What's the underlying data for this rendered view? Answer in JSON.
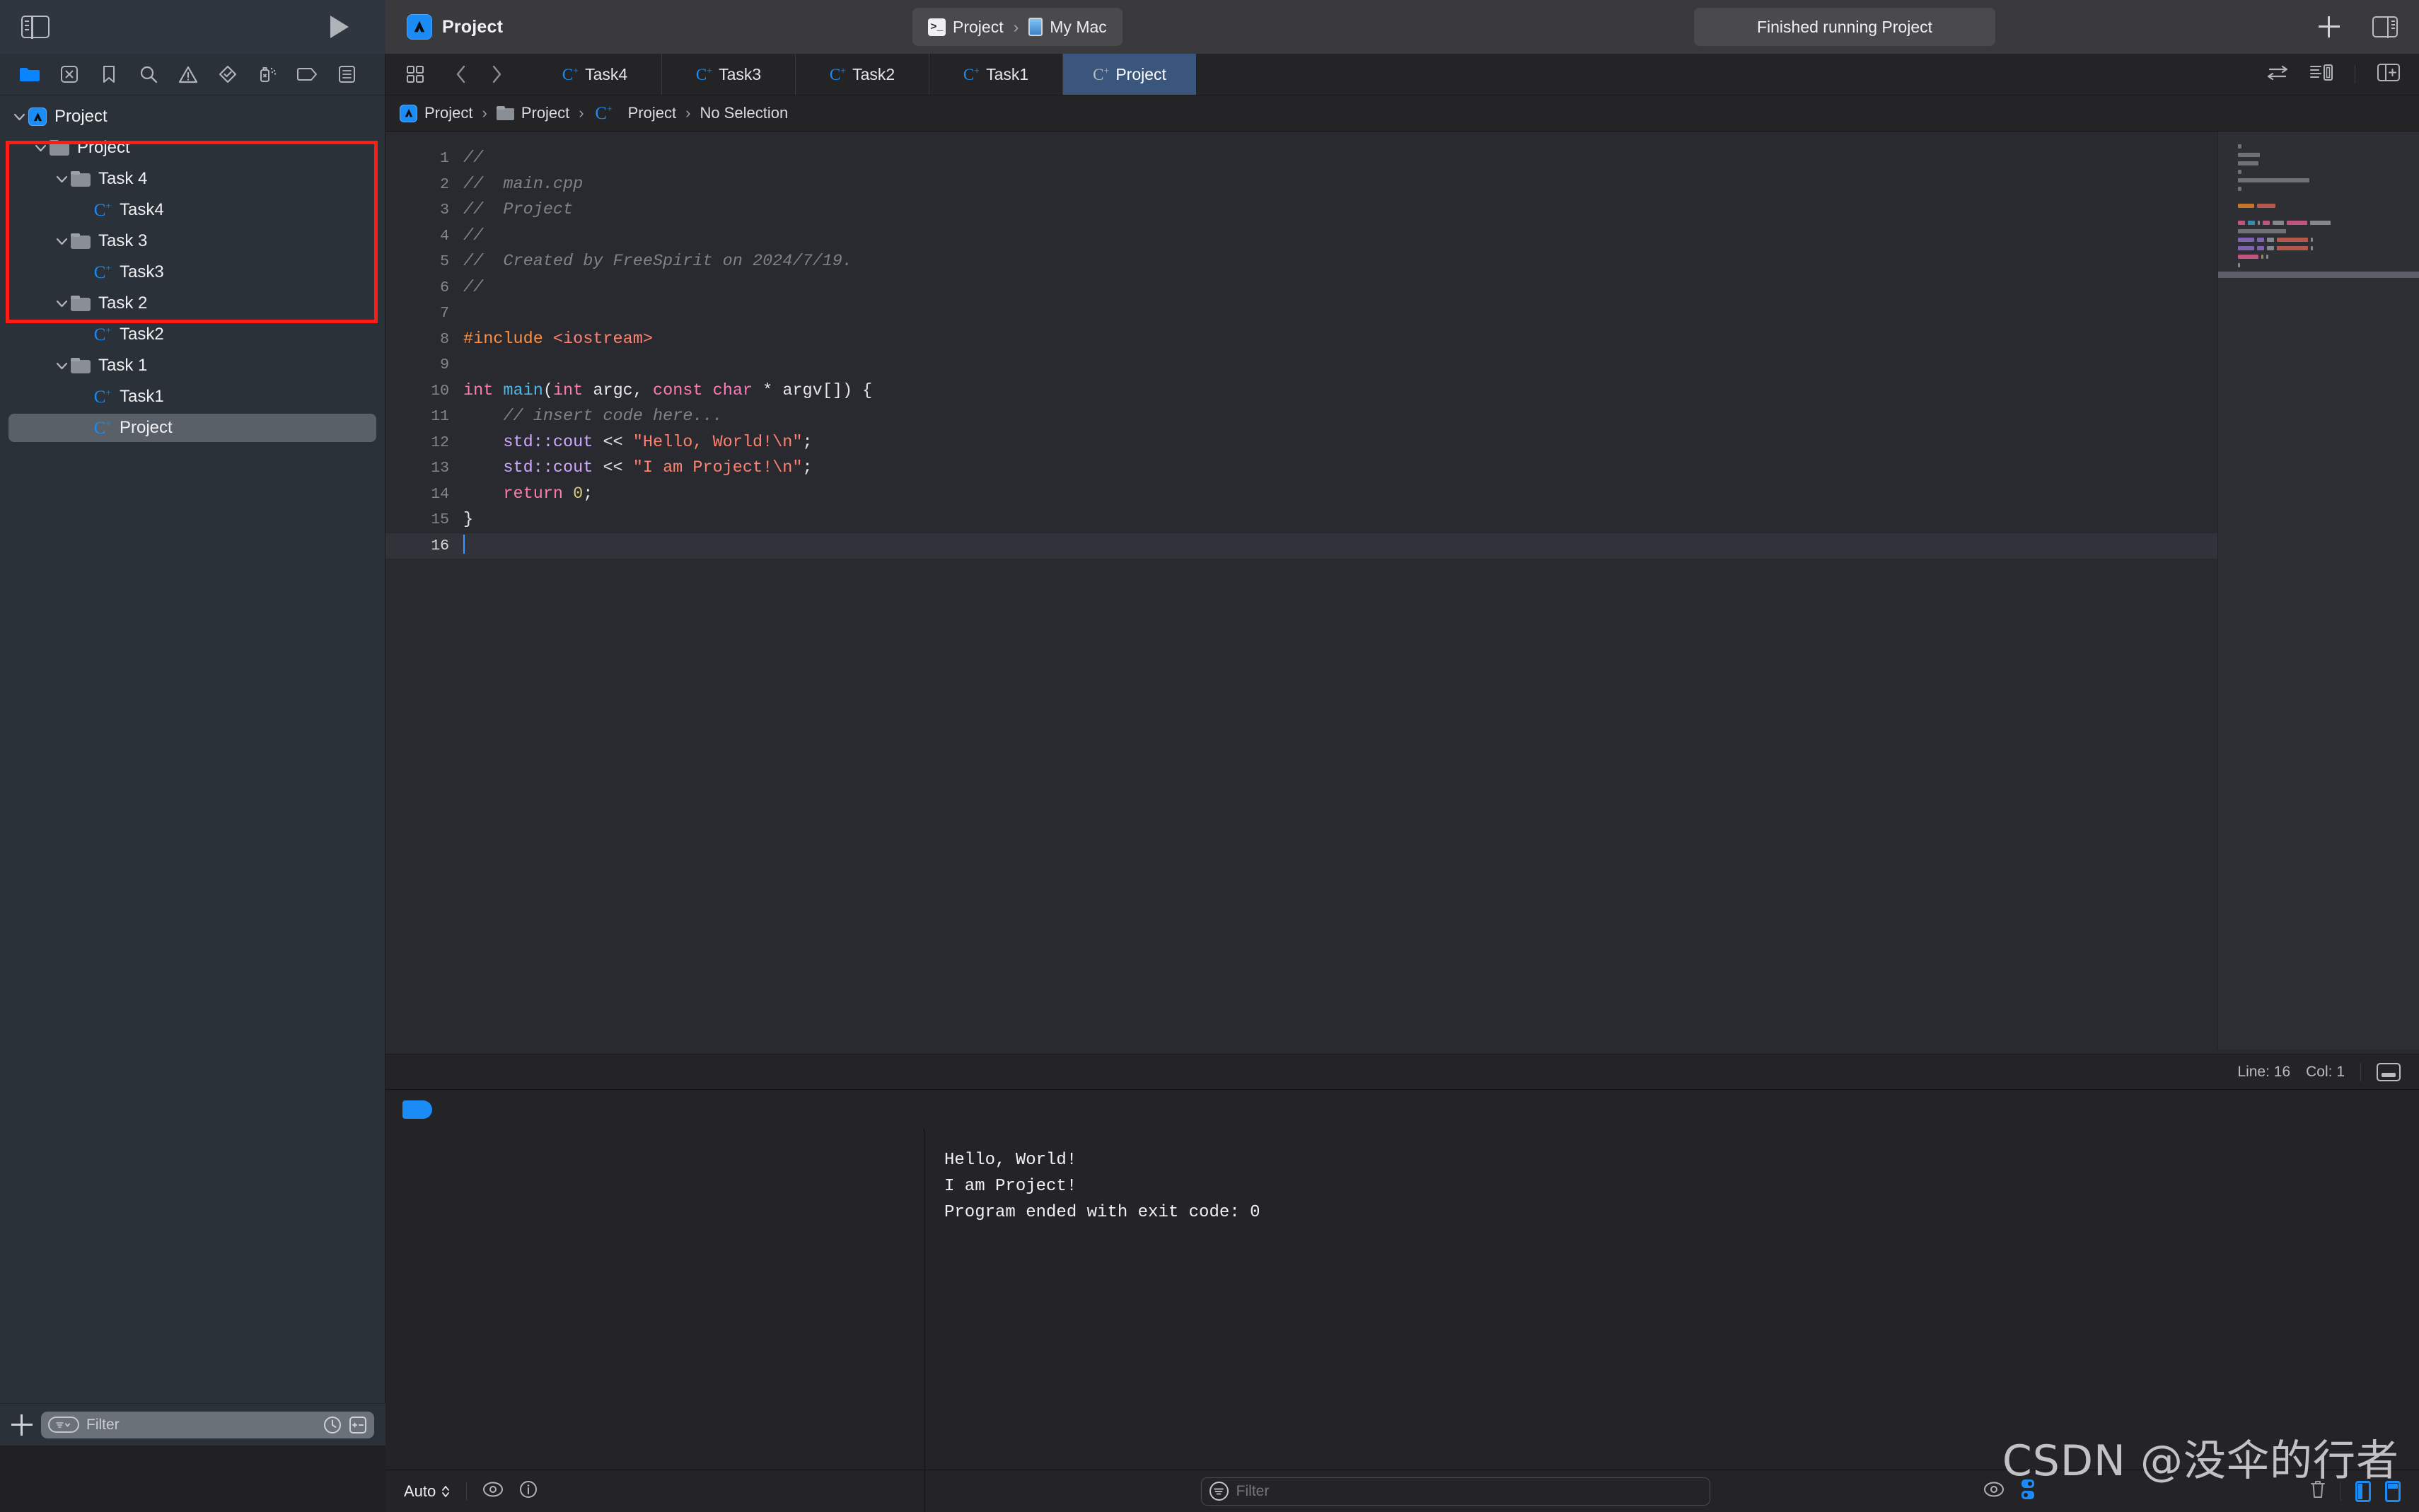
{
  "titlebar": {
    "app_title": "Project",
    "app_icon": "xcode-app-icon",
    "scheme": {
      "name": "Project",
      "icon": "scheme-icon",
      "separator": "›",
      "destination": "My Mac",
      "destination_icon": "mac-device-icon"
    },
    "status": "Finished running Project",
    "run_button": "run-button",
    "add_button": "+",
    "left_toggle": "sidebar-toggle-icon",
    "right_toggle": "inspector-toggle-icon"
  },
  "navigator": {
    "icon_bar": [
      {
        "name": "project-navigator-icon",
        "active": true
      },
      {
        "name": "source-control-navigator-icon",
        "active": false
      },
      {
        "name": "bookmark-navigator-icon",
        "active": false
      },
      {
        "name": "find-navigator-icon",
        "active": false
      },
      {
        "name": "issue-navigator-icon",
        "active": false
      },
      {
        "name": "test-navigator-icon",
        "active": false
      },
      {
        "name": "debug-navigator-icon",
        "active": false
      },
      {
        "name": "breakpoint-navigator-icon",
        "active": false
      },
      {
        "name": "report-navigator-icon",
        "active": false
      }
    ],
    "tree": [
      {
        "label": "Project",
        "icon": "xcode-project-icon",
        "indent": 0,
        "expanded": true,
        "selected": false
      },
      {
        "label": "Project",
        "icon": "folder-icon",
        "indent": 1,
        "expanded": true,
        "selected": false
      },
      {
        "label": "Task 4",
        "icon": "folder-icon",
        "indent": 2,
        "expanded": true,
        "selected": false
      },
      {
        "label": "Task4",
        "icon": "cpp-file-icon",
        "indent": 3,
        "expanded": null,
        "selected": false
      },
      {
        "label": "Task 3",
        "icon": "folder-icon",
        "indent": 2,
        "expanded": true,
        "selected": false
      },
      {
        "label": "Task3",
        "icon": "cpp-file-icon",
        "indent": 3,
        "expanded": null,
        "selected": false
      },
      {
        "label": "Task 2",
        "icon": "folder-icon",
        "indent": 2,
        "expanded": true,
        "selected": false
      },
      {
        "label": "Task2",
        "icon": "cpp-file-icon",
        "indent": 3,
        "expanded": null,
        "selected": false
      },
      {
        "label": "Task 1",
        "icon": "folder-icon",
        "indent": 2,
        "expanded": true,
        "selected": false
      },
      {
        "label": "Task1",
        "icon": "cpp-file-icon",
        "indent": 3,
        "expanded": null,
        "selected": false
      },
      {
        "label": "Project",
        "icon": "cpp-file-icon",
        "indent": 3,
        "expanded": null,
        "selected": true
      }
    ],
    "highlight_box_color": "#ff1c14",
    "bottom": {
      "add_label": "+",
      "filter_placeholder": "Filter",
      "recent_icon": "clock-icon",
      "sourcecontrol_icon": "plus-minus-icon"
    }
  },
  "tabbar": {
    "grid_icon": "tab-overview-icon",
    "back_icon": "navigate-back-icon",
    "forward_icon": "navigate-forward-icon",
    "tabs": [
      {
        "label": "Task4",
        "active": false
      },
      {
        "label": "Task3",
        "active": false
      },
      {
        "label": "Task2",
        "active": false
      },
      {
        "label": "Task1",
        "active": false
      },
      {
        "label": "Project",
        "active": true
      }
    ],
    "right_icons": [
      {
        "name": "adjust-editor-options-icon"
      },
      {
        "name": "code-review-icon"
      },
      {
        "name": "add-editor-icon"
      }
    ]
  },
  "breadcrumb": {
    "items": [
      "Project",
      "Project",
      "Project",
      "No Selection"
    ],
    "separator": "›",
    "icons": [
      "xcode-project-icon",
      "folder-icon",
      "cpp-file-icon",
      null
    ]
  },
  "editor": {
    "lines": [
      {
        "n": "1",
        "tokens": [
          {
            "t": "//",
            "c": "cm"
          }
        ]
      },
      {
        "n": "2",
        "tokens": [
          {
            "t": "//  main.cpp",
            "c": "cm"
          }
        ]
      },
      {
        "n": "3",
        "tokens": [
          {
            "t": "//  Project",
            "c": "cm"
          }
        ]
      },
      {
        "n": "4",
        "tokens": [
          {
            "t": "//",
            "c": "cm"
          }
        ]
      },
      {
        "n": "5",
        "tokens": [
          {
            "t": "//  Created by FreeSpirit on 2024/7/19.",
            "c": "cm"
          }
        ]
      },
      {
        "n": "6",
        "tokens": [
          {
            "t": "//",
            "c": "cm"
          }
        ]
      },
      {
        "n": "7",
        "tokens": []
      },
      {
        "n": "8",
        "tokens": [
          {
            "t": "#include ",
            "c": "pp"
          },
          {
            "t": "<iostream>",
            "c": "st"
          }
        ]
      },
      {
        "n": "9",
        "tokens": []
      },
      {
        "n": "10",
        "tokens": [
          {
            "t": "int ",
            "c": "k"
          },
          {
            "t": "main",
            "c": "fn"
          },
          {
            "t": "(",
            "c": "pl"
          },
          {
            "t": "int ",
            "c": "k"
          },
          {
            "t": "argc, ",
            "c": "pl"
          },
          {
            "t": "const char ",
            "c": "k"
          },
          {
            "t": "* argv[]) {",
            "c": "pl"
          }
        ]
      },
      {
        "n": "11",
        "tokens": [
          {
            "t": "    // insert code here...",
            "c": "cm"
          }
        ]
      },
      {
        "n": "12",
        "tokens": [
          {
            "t": "    std::",
            "c": "ty"
          },
          {
            "t": "cout",
            "c": "ty"
          },
          {
            "t": " << ",
            "c": "pl"
          },
          {
            "t": "\"Hello, World!\\n\"",
            "c": "st"
          },
          {
            "t": ";",
            "c": "pl"
          }
        ]
      },
      {
        "n": "13",
        "tokens": [
          {
            "t": "    std::",
            "c": "ty"
          },
          {
            "t": "cout",
            "c": "ty"
          },
          {
            "t": " << ",
            "c": "pl"
          },
          {
            "t": "\"I am Project!\\n\"",
            "c": "st"
          },
          {
            "t": ";",
            "c": "pl"
          }
        ]
      },
      {
        "n": "14",
        "tokens": [
          {
            "t": "    return ",
            "c": "k"
          },
          {
            "t": "0",
            "c": "nm"
          },
          {
            "t": ";",
            "c": "pl"
          }
        ]
      },
      {
        "n": "15",
        "tokens": [
          {
            "t": "}",
            "c": "pl"
          }
        ]
      },
      {
        "n": "16",
        "tokens": [],
        "current": true,
        "caret": true
      }
    ],
    "status": {
      "line_label": "Line: 16",
      "col_label": "Col: 1",
      "minimap_toggle": "minimap-toggle-icon"
    }
  },
  "debug": {
    "breakpoint_tag": "breakpoint-activate-icon",
    "variables_pane": {
      "content": ""
    },
    "console": [
      "Hello, World!",
      "I am Project!",
      "Program ended with exit code: 0"
    ],
    "bottom": {
      "auto_label": "Auto",
      "eye_icon": "show-variables-icon",
      "info_icon": "info-icon",
      "filter_placeholder": "Filter",
      "console_eye_icon": "console-show-icon",
      "split_icon": "split-console-icon",
      "trash_icon": "clear-console-icon",
      "left_panel_icon": "toggle-variables-panel-icon",
      "right_panel_icon": "toggle-console-panel-icon"
    }
  },
  "watermark": "CSDN @没伞的行者"
}
